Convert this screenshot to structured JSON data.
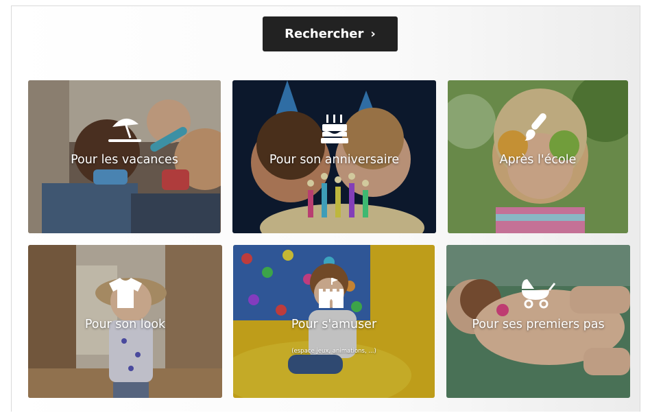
{
  "search": {
    "label": "Rechercher",
    "chevron_icon": "chevron-right-icon"
  },
  "cards": [
    {
      "label": "Pour les vacances",
      "icon": "beach-umbrella-icon"
    },
    {
      "label": "Pour son anniversaire",
      "icon": "birthday-cake-icon"
    },
    {
      "label": "Après l'école",
      "icon": "paintbrush-icon"
    },
    {
      "label": "Pour son look",
      "icon": "tshirt-icon"
    },
    {
      "label": "Pour s'amuser",
      "sub": "(espace jeux, animations, ...)",
      "icon": "castle-icon"
    },
    {
      "label": "Pour ses premiers pas",
      "icon": "baby-stroller-icon"
    }
  ],
  "colors": {
    "button_bg": "#222222",
    "label_text": "#ffffff"
  }
}
